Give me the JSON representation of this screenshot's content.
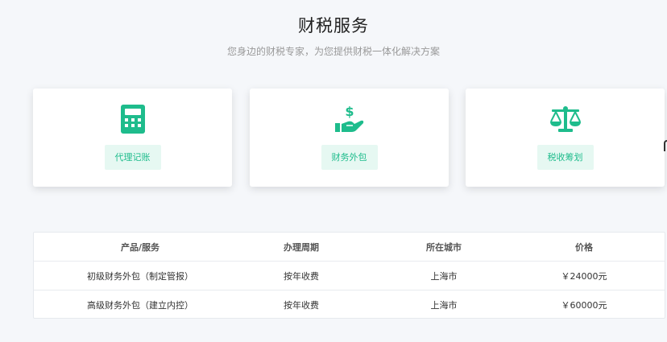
{
  "header": {
    "title": "财税服务",
    "subtitle": "您身边的财税专家，为您提供财税一体化解决方案"
  },
  "cards": [
    {
      "label": "代理记账",
      "icon": "calculator-icon"
    },
    {
      "label": "财务外包",
      "icon": "hand-money-icon"
    },
    {
      "label": "税收筹划",
      "icon": "scale-icon"
    }
  ],
  "colors": {
    "accent": "#1ebc8c",
    "tag_bg": "#e6f8f2"
  },
  "table": {
    "columns": [
      "产品/服务",
      "办理周期",
      "所在城市",
      "价格"
    ],
    "rows": [
      [
        "初级财务外包（制定管报）",
        "按年收费",
        "上海市",
        "￥24000元"
      ],
      [
        "高级财务外包（建立内控）",
        "按年收费",
        "上海市",
        "￥60000元"
      ]
    ]
  }
}
